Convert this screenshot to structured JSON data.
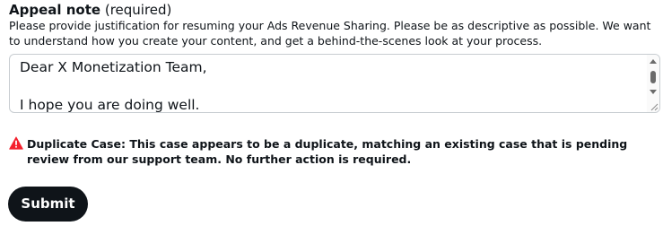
{
  "appeal": {
    "label_title": "Appeal note",
    "label_required": "(required)",
    "helper_text": "Please provide justification for resuming your Ads Revenue Sharing. Please be as descriptive as possible. We want to understand how you create your content, and get a behind-the-scenes look at your process.",
    "textarea_line1": "Dear X Monetization Team,",
    "textarea_line2": "I hope you are doing well."
  },
  "warning": {
    "icon": "warning-triangle-icon",
    "color": "#f4212e",
    "text": "Duplicate Case: This case appears to be a duplicate, matching an existing case that is pending review from our support team. No further action is required."
  },
  "submit": {
    "label": "Submit",
    "bg_color": "#0f1419"
  }
}
